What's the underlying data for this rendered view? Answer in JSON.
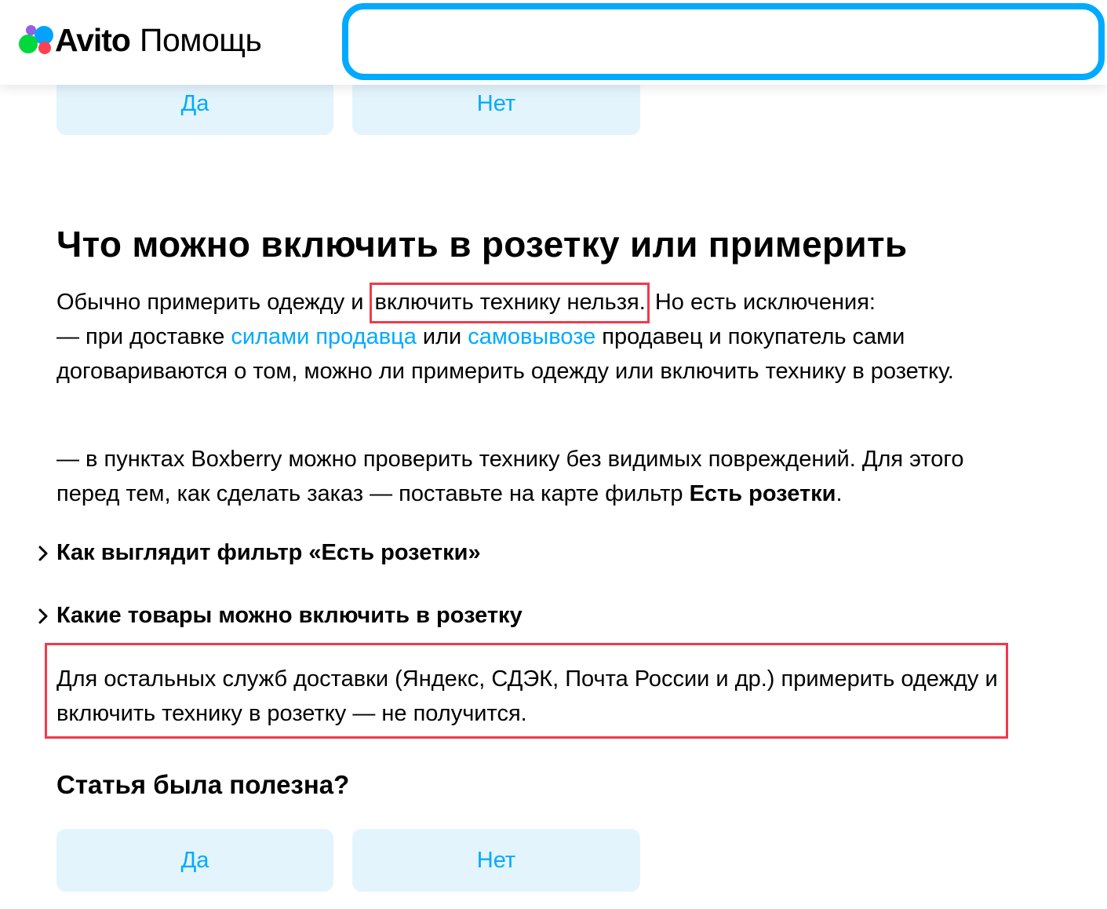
{
  "header": {
    "brand": "Avito",
    "section": "Помощь",
    "search_value": ""
  },
  "colors": {
    "accent": "#00aaff",
    "button_bg": "#e3f4fd",
    "highlight": "#f03a4b"
  },
  "feedback_top": {
    "yes": "Да",
    "no": "Нет"
  },
  "article": {
    "title": "Что можно включить в розетку или примерить",
    "p1": {
      "t1": "Обычно примерить одежду и ",
      "highlight": "включить технику нельзя.",
      "t2": " Но есть исключения:",
      "t3": "— при доставке ",
      "link1": "силами продавца",
      "t4": " или ",
      "link2": "самовывозе",
      "t5": " продавец и покупатель сами договариваются о том, можно ли примерить одежду или включить технику в розетку."
    },
    "p2": {
      "t1": "— в пунктах Boxberry можно проверить технику без видимых повреждений. Для этого перед тем, как сделать заказ — поставьте на карте фильтр ",
      "bold": "Есть розетки",
      "t2": "."
    },
    "accordions": [
      {
        "label": "Как выглядит фильтр «Есть розетки»",
        "icon": "chevron-right-icon"
      },
      {
        "label": "Какие товары можно включить в розетку",
        "icon": "chevron-right-icon"
      }
    ],
    "note": "Для остальных служб доставки (Яндекс, СДЭК, Почта России и др.) примерить одежду и включить технику в розетку — не получится."
  },
  "feedback": {
    "question": "Статья была полезна?",
    "yes": "Да",
    "no": "Нет"
  }
}
